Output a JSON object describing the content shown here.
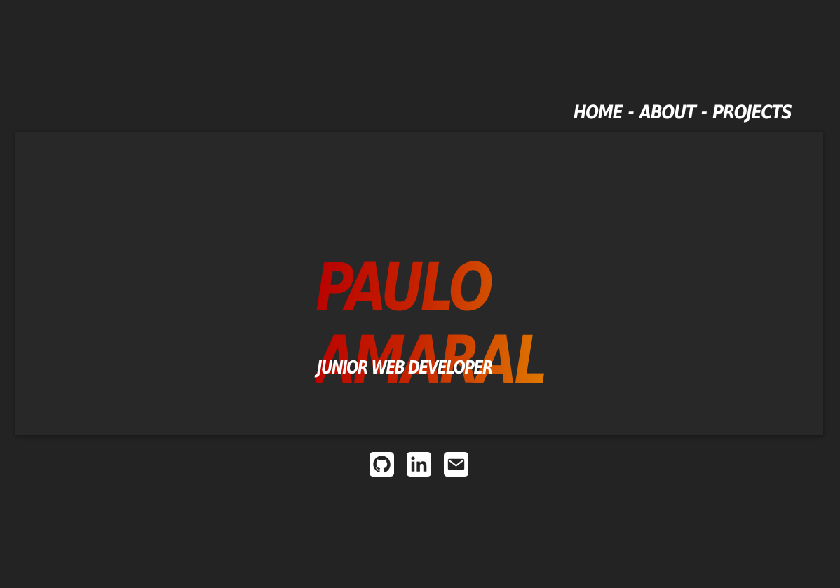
{
  "nav": {
    "items": [
      {
        "label": "HOME"
      },
      {
        "label": "ABOUT"
      },
      {
        "label": "PROJECTS"
      }
    ],
    "separator": "-"
  },
  "hero": {
    "first_name": "PAULO",
    "last_name": "AMARAL",
    "subtitle": "JUNIOR WEB DEVELOPER"
  },
  "social": {
    "icons": [
      "github-icon",
      "linkedin-icon",
      "email-icon"
    ]
  },
  "colors": {
    "background": "#232323",
    "card": "#282828",
    "gradient_start": "#b80000",
    "gradient_end": "#e07a00",
    "text": "#ffffff"
  }
}
